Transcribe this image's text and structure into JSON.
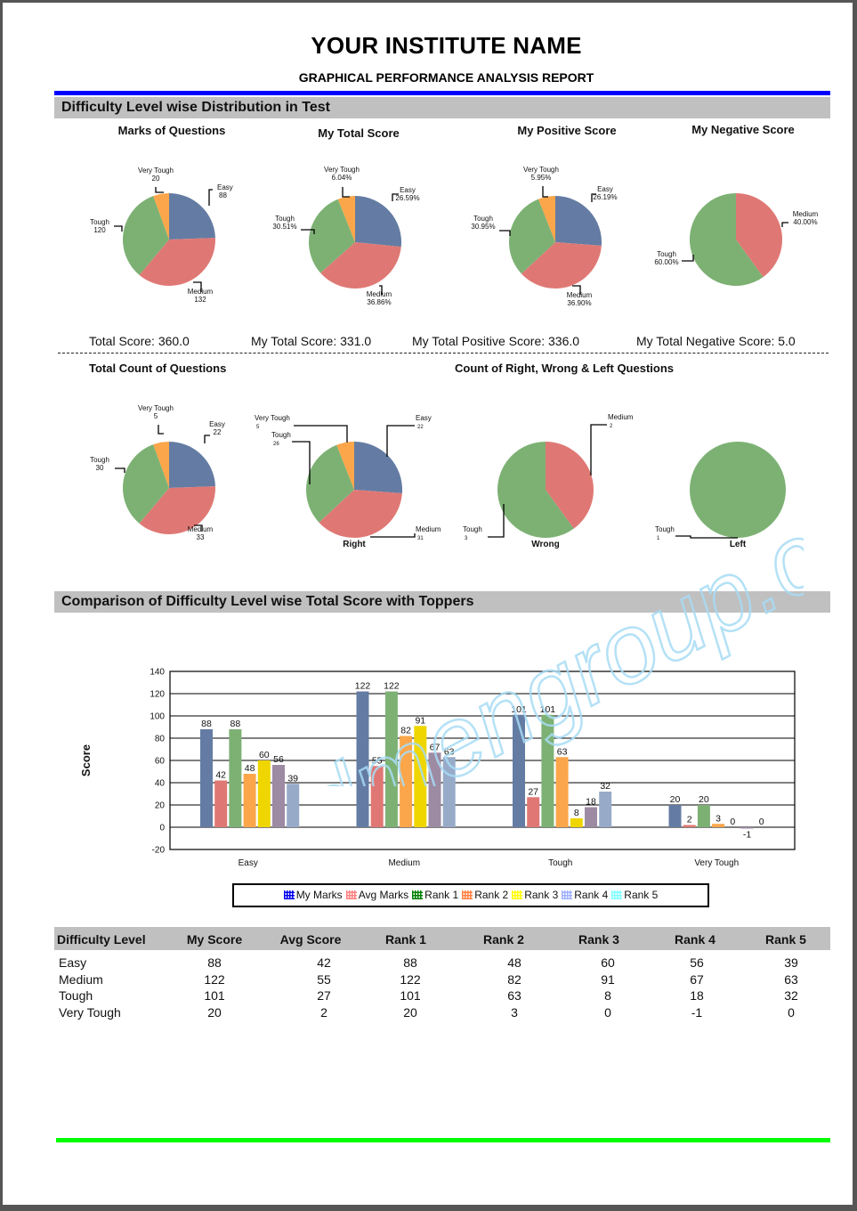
{
  "header": {
    "title": "YOUR INSTITUTE NAME",
    "subtitle": "GRAPHICAL PERFORMANCE ANALYSIS REPORT",
    "top_rule_color": "#0000ff",
    "bottom_rule_color": "#00ff00"
  },
  "sections": {
    "distribution": "Difficulty Level wise Distribution in Test",
    "comparison": "Comparison of Difficulty Level wise Total Score with Toppers"
  },
  "colors": {
    "Easy": "#647ca3",
    "Medium": "#df7874",
    "Tough": "#7db174",
    "Very Tough": "#fba64a"
  },
  "score_summary": {
    "total_score": "Total Score: 360.0",
    "my_total_score": "My Total Score: 331.0",
    "my_total_positive": "My Total Positive Score:   336.0",
    "my_total_negative": "My Total Negative Score: 5.0"
  },
  "subsection_titles": {
    "total_count": "Total Count of Questions",
    "right_wrong_left": "Count of Right, Wrong & Left Questions"
  },
  "watermark": "admengroup.com",
  "chart_data": [
    {
      "type": "pie",
      "title": "Marks of Questions",
      "slices": [
        {
          "label": "Easy",
          "value": 88,
          "display": "88"
        },
        {
          "label": "Medium",
          "value": 132,
          "display": "132"
        },
        {
          "label": "Tough",
          "value": 120,
          "display": "120"
        },
        {
          "label": "Very Tough",
          "value": 20,
          "display": "20"
        }
      ]
    },
    {
      "type": "pie",
      "title": "My Total Score",
      "slices": [
        {
          "label": "Easy",
          "value": 26.59,
          "display": "26.59%"
        },
        {
          "label": "Medium",
          "value": 36.86,
          "display": "36.86%"
        },
        {
          "label": "Tough",
          "value": 30.51,
          "display": "30.51%"
        },
        {
          "label": "Very Tough",
          "value": 6.04,
          "display": "6.04%"
        }
      ]
    },
    {
      "type": "pie",
      "title": "My Positive Score",
      "slices": [
        {
          "label": "Easy",
          "value": 26.19,
          "display": "26.19%"
        },
        {
          "label": "Medium",
          "value": 36.9,
          "display": "36.90%"
        },
        {
          "label": "Tough",
          "value": 30.95,
          "display": "30.95%"
        },
        {
          "label": "Very Tough",
          "value": 5.95,
          "display": "5.95%"
        }
      ]
    },
    {
      "type": "pie",
      "title": "My Negative Score",
      "slices": [
        {
          "label": "Medium",
          "value": 40.0,
          "display": "40.00%"
        },
        {
          "label": "Tough",
          "value": 60.0,
          "display": "60.00%"
        }
      ]
    },
    {
      "type": "pie",
      "title": "Total Count of Questions",
      "slices": [
        {
          "label": "Easy",
          "value": 22,
          "display": "22"
        },
        {
          "label": "Medium",
          "value": 33,
          "display": "33"
        },
        {
          "label": "Tough",
          "value": 30,
          "display": "30"
        },
        {
          "label": "Very Tough",
          "value": 5,
          "display": "5"
        }
      ]
    },
    {
      "type": "pie",
      "title": "Right",
      "slices": [
        {
          "label": "Easy",
          "value": 22,
          "display": "22"
        },
        {
          "label": "Medium",
          "value": 31,
          "display": "31"
        },
        {
          "label": "Tough",
          "value": 26,
          "display": "26"
        },
        {
          "label": "Very Tough",
          "value": 5,
          "display": "5"
        }
      ]
    },
    {
      "type": "pie",
      "title": "Wrong",
      "slices": [
        {
          "label": "Medium",
          "value": 2,
          "display": "2"
        },
        {
          "label": "Tough",
          "value": 3,
          "display": "3"
        }
      ]
    },
    {
      "type": "pie",
      "title": "Left",
      "slices": [
        {
          "label": "Tough",
          "value": 1,
          "display": "1"
        }
      ]
    },
    {
      "type": "bar",
      "title": "Comparison of Difficulty Level wise Total Score with Toppers",
      "xlabel": "",
      "ylabel": "Score",
      "ylim": [
        -20,
        140
      ],
      "yticks": [
        -20,
        0,
        20,
        40,
        60,
        80,
        100,
        120,
        140
      ],
      "grid": true,
      "legend_position": "bottom",
      "categories": [
        "Easy",
        "Medium",
        "Tough",
        "Very Tough"
      ],
      "series": [
        {
          "name": "My Marks",
          "color": "#647ca3",
          "legend_color": "#0000ee",
          "values": [
            88,
            122,
            101,
            20
          ]
        },
        {
          "name": "Avg Marks",
          "color": "#df7874",
          "legend_color": "#ff8080",
          "values": [
            42,
            55,
            27,
            2
          ]
        },
        {
          "name": "Rank 1",
          "color": "#7db174",
          "legend_color": "#008000",
          "values": [
            88,
            122,
            101,
            20
          ]
        },
        {
          "name": "Rank 2",
          "color": "#fba64a",
          "legend_color": "#ff8040",
          "values": [
            48,
            82,
            63,
            3
          ]
        },
        {
          "name": "Rank 3",
          "color": "#efd600",
          "legend_color": "#ffff00",
          "values": [
            60,
            91,
            8,
            0
          ]
        },
        {
          "name": "Rank 4",
          "color": "#9d8aa3",
          "legend_color": "#a0b0ff",
          "values": [
            56,
            67,
            18,
            -1
          ]
        },
        {
          "name": "Rank 5",
          "color": "#97abc9",
          "legend_color": "#80ffff",
          "values": [
            39,
            63,
            32,
            0
          ]
        }
      ]
    }
  ],
  "table": {
    "headers": [
      "Difficulty Level",
      "My Score",
      "Avg Score",
      "Rank 1",
      "Rank 2",
      "Rank 3",
      "Rank 4",
      "Rank 5"
    ],
    "rows": [
      [
        "Easy",
        "88",
        "42",
        "88",
        "48",
        "60",
        "56",
        "39"
      ],
      [
        "Medium",
        "122",
        "55",
        "122",
        "82",
        "91",
        "67",
        "63"
      ],
      [
        "Tough",
        "101",
        "27",
        "101",
        "63",
        "8",
        "18",
        "32"
      ],
      [
        "Very Tough",
        "20",
        "2",
        "20",
        "3",
        "0",
        "-1",
        "0"
      ]
    ]
  }
}
